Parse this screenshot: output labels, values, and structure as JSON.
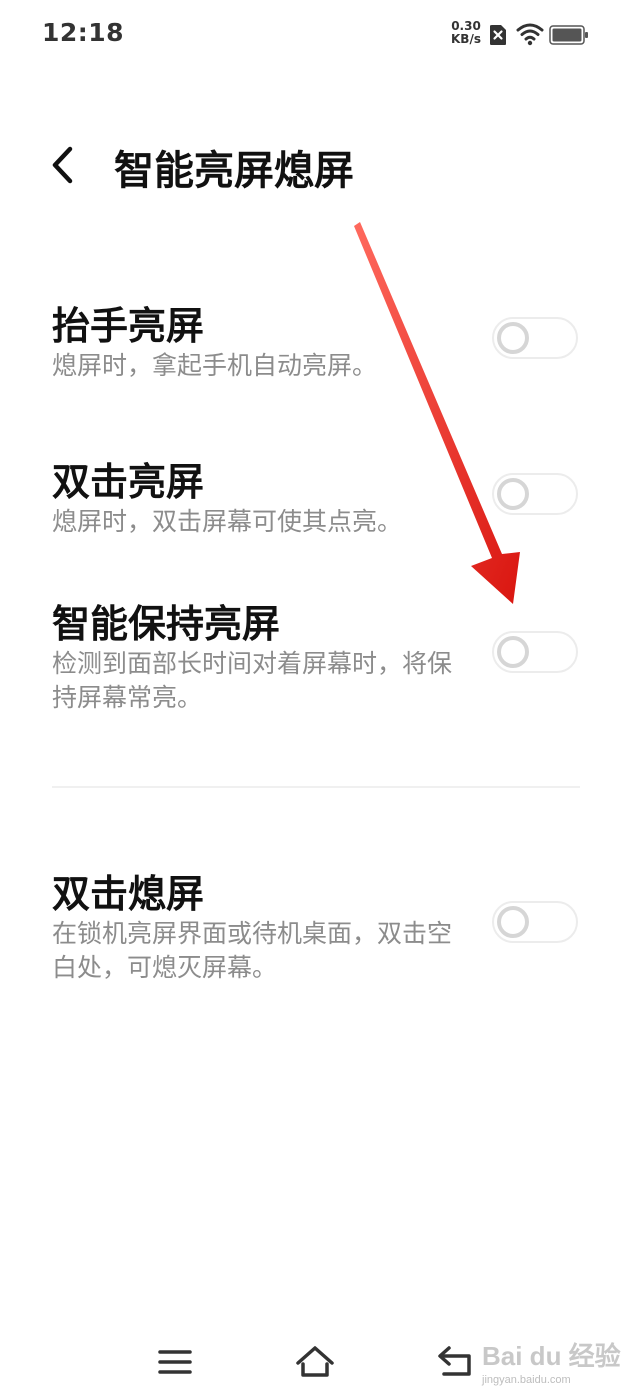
{
  "status_bar": {
    "time": "12:18",
    "net_speed_value": "0.30",
    "net_speed_unit": "KB/s",
    "icons": [
      "sim-blocked-icon",
      "wifi-icon",
      "battery-icon"
    ]
  },
  "header": {
    "back_icon": "chevron-left-icon",
    "title": "智能亮屏熄屏"
  },
  "settings": [
    {
      "title": "抬手亮屏",
      "description": "熄屏时，拿起手机自动亮屏。",
      "enabled": false
    },
    {
      "title": "双击亮屏",
      "description": "熄屏时，双击屏幕可使其点亮。",
      "enabled": false
    },
    {
      "title": "智能保持亮屏",
      "description": "检测到面部长时间对着屏幕时，将保持屏幕常亮。",
      "enabled": false
    },
    {
      "title": "双击熄屏",
      "description": "在锁机亮屏界面或待机桌面，双击空白处，可熄灭屏幕。",
      "enabled": false
    }
  ],
  "nav_bar": {
    "icons": [
      "menu-icon",
      "home-icon",
      "back-return-icon"
    ]
  },
  "watermark": {
    "main": "Bai du 经验",
    "sub": "jingyan.baidu.com"
  },
  "colors": {
    "annotation_arrow": "#e8201e",
    "description_text": "#8c8c8c",
    "toggle_off": "#d6d6d6"
  }
}
